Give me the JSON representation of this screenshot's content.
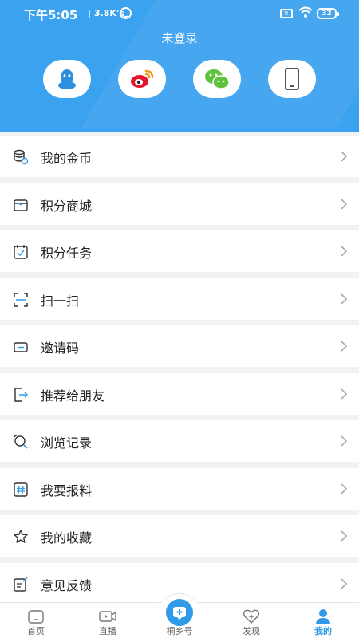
{
  "statusbar": {
    "time": "下午5:05",
    "speed": "| 3.8K's",
    "battery": "32"
  },
  "header": {
    "login_title": "未登录",
    "login_options": [
      "qq-login",
      "weibo-login",
      "wechat-login",
      "phone-login"
    ]
  },
  "menu": {
    "items": [
      {
        "label": "我的金币",
        "icon": "coins-icon"
      },
      {
        "label": "积分商城",
        "icon": "store-icon"
      },
      {
        "label": "积分任务",
        "icon": "task-calendar-icon"
      },
      {
        "label": "扫一扫",
        "icon": "scan-icon"
      },
      {
        "label": "邀请码",
        "icon": "ticket-icon"
      },
      {
        "label": "推荐给朋友",
        "icon": "share-arrow-icon"
      },
      {
        "label": "浏览记录",
        "icon": "history-search-icon"
      },
      {
        "label": "我要报料",
        "icon": "hashtag-icon"
      },
      {
        "label": "我的收藏",
        "icon": "star-icon"
      },
      {
        "label": "意见反馈",
        "icon": "feedback-icon"
      }
    ]
  },
  "tabbar": {
    "tabs": [
      {
        "label": "首页",
        "icon": "home-icon"
      },
      {
        "label": "直播",
        "icon": "live-video-icon"
      },
      {
        "label": "桐乡号",
        "icon": "tongxiang-hao-icon"
      },
      {
        "label": "发现",
        "icon": "discover-heart-icon"
      },
      {
        "label": "我的",
        "icon": "profile-icon"
      }
    ],
    "active_index": 4
  },
  "colors": {
    "header_bg": "#3ba2f0",
    "accent": "#2f9be8",
    "page_bg": "#f2f2f4"
  }
}
